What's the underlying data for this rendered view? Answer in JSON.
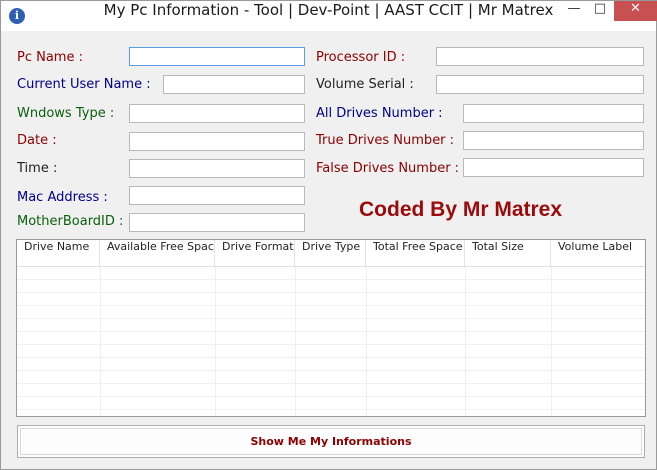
{
  "window": {
    "title": "My Pc Information - Tool | Dev-Point | AAST CCIT | Mr Matrex",
    "icon": "info-icon",
    "minimize": "—",
    "maximize": "□",
    "close": "✕"
  },
  "form": {
    "pc_name": {
      "label": "Pc Name :",
      "value": ""
    },
    "current_user_name": {
      "label": "Current User Name :",
      "value": ""
    },
    "windows_type": {
      "label": "Wndows Type :",
      "value": ""
    },
    "date": {
      "label": "Date  :",
      "value": ""
    },
    "time": {
      "label": "Time  :",
      "value": ""
    },
    "mac_address": {
      "label": "Mac Address :",
      "value": ""
    },
    "motherboard_id": {
      "label": "MotherBoardID :",
      "value": ""
    },
    "processor_id": {
      "label": "Processor ID :",
      "value": ""
    },
    "volume_serial": {
      "label": "Volume Serial :",
      "value": ""
    },
    "all_drives_number": {
      "label": "All Drives Number  :",
      "value": ""
    },
    "true_drives_number": {
      "label": "True Drives Number  :",
      "value": ""
    },
    "false_drives_number": {
      "label": "False Drives Number  :",
      "value": ""
    }
  },
  "credit": "Coded By Mr Matrex",
  "grid": {
    "columns": [
      "Drive Name",
      "Available Free Space",
      "Drive Format",
      "Drive Type",
      "Total Free Space",
      "Total Size",
      "Volume Label"
    ]
  },
  "actions": {
    "show_button": "Show Me My Informations"
  },
  "colors": {
    "label_red": "#8b0000",
    "label_blue": "#00008b",
    "label_green": "#0b5f0b",
    "credit": "#9b0b0b",
    "close_button": "#c75050"
  }
}
